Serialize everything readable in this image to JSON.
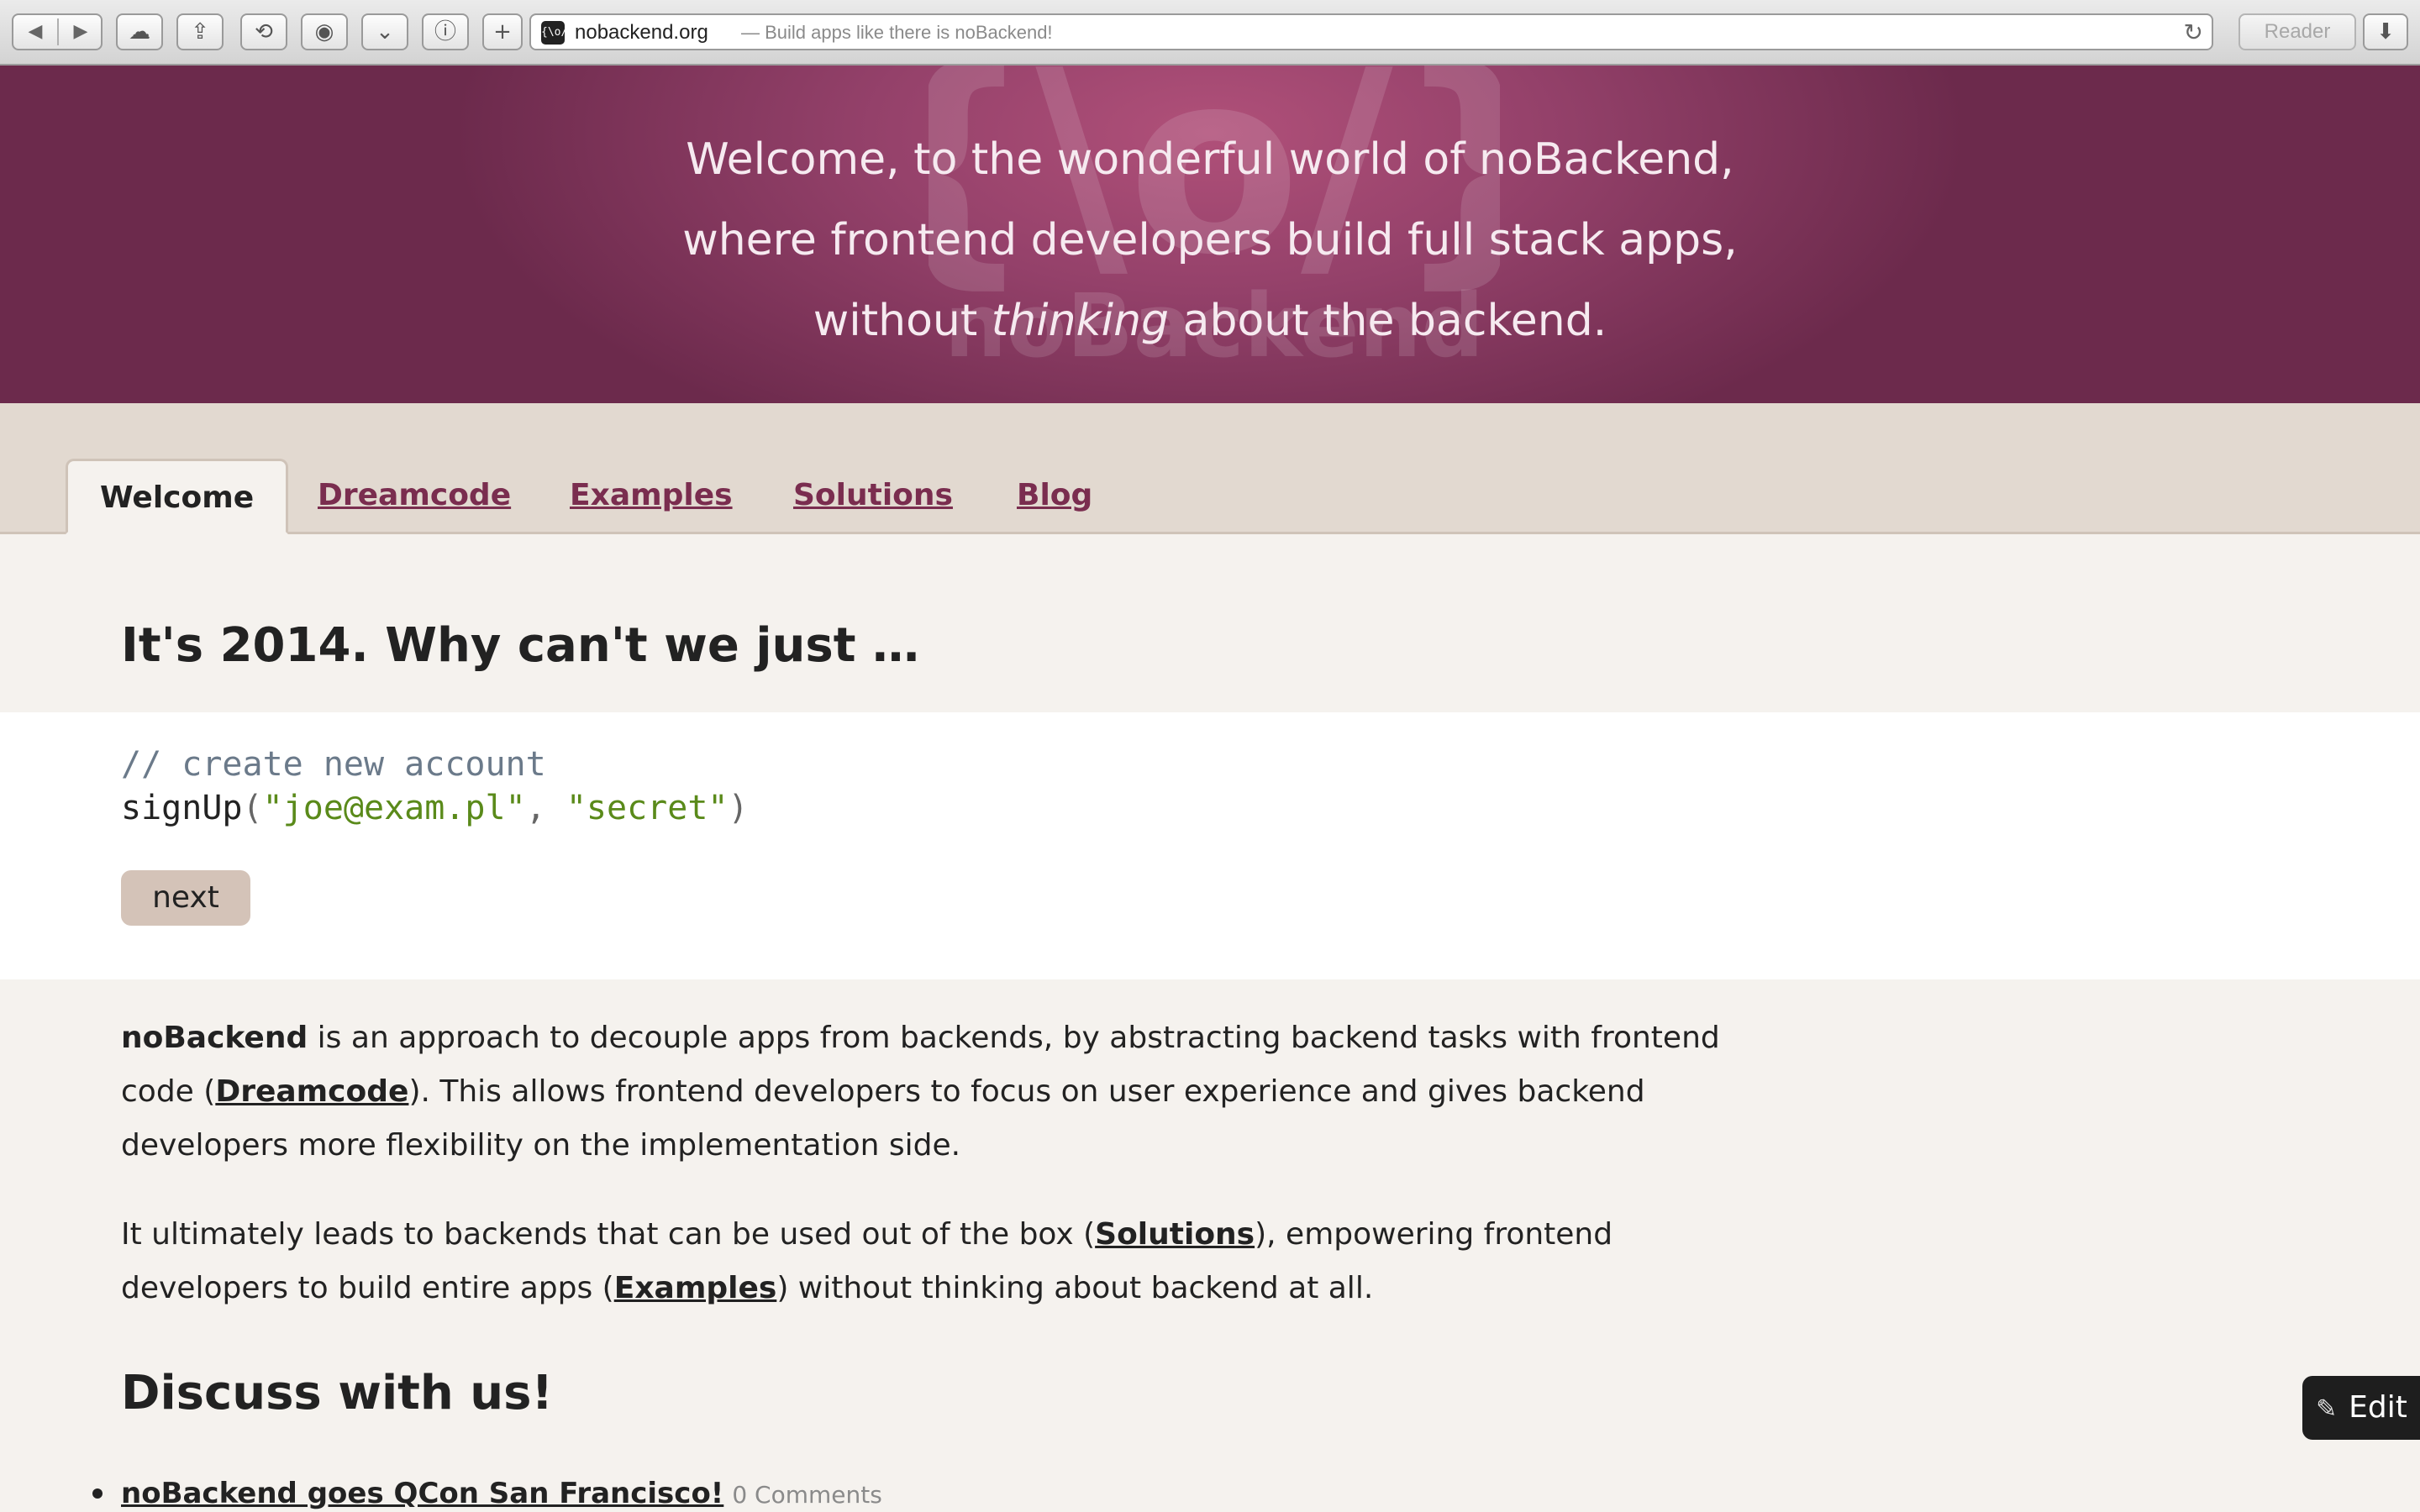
{
  "browser": {
    "url_domain": "nobackend.org",
    "url_title": "— Build apps like there is noBackend!",
    "favicon_text": "{\\o/}",
    "reader_label": "Reader",
    "buttons": [
      "back-icon",
      "forward-icon",
      "icloud-icon",
      "share-icon",
      "history-icon",
      "bookmark-icon",
      "pocket-icon",
      "info-icon",
      "new-tab-icon",
      "reload-icon",
      "downloads-icon"
    ]
  },
  "banner": {
    "line1": "Welcome, to the wonderful world of noBackend,",
    "line2": "where frontend developers build full stack apps,",
    "line3_pre": "without ",
    "line3_em": "thinking",
    "line3_post": " about the backend.",
    "logo_text": "noBackend",
    "logo_mark": "{\\o/}"
  },
  "tabs": [
    {
      "label": "Welcome",
      "active": true
    },
    {
      "label": "Dreamcode",
      "active": false
    },
    {
      "label": "Examples",
      "active": false
    },
    {
      "label": "Solutions",
      "active": false
    },
    {
      "label": "Blog",
      "active": false
    }
  ],
  "intro": {
    "heading": "It's 2014. Why can't we just …"
  },
  "code": {
    "comment": "// create new account",
    "fn": "signUp",
    "open": "(",
    "arg1": "\"joe@exam.pl\"",
    "comma": ", ",
    "arg2": "\"secret\"",
    "close": ")",
    "next_label": "next"
  },
  "para1": {
    "strong": "noBackend",
    "t1": " is an approach to decouple apps from backends, by abstracting backend tasks with frontend code (",
    "link": "Dreamcode",
    "t2": "). This allows frontend developers to focus on user experience and gives backend developers more flexibility on the implementation side."
  },
  "para2": {
    "t1": "It ultimately leads to backends that can be used out of the box (",
    "link1": "Solutions",
    "t2": "), empowering frontend developers to build entire apps (",
    "link2": "Examples",
    "t3": ") without thinking about backend at all."
  },
  "discuss": {
    "heading": "Discuss with us!",
    "items": [
      {
        "title": "noBackend goes QCon San Francisco!",
        "meta": "0 Comments"
      }
    ]
  },
  "edit": {
    "label": "Edit",
    "icon": "pencil-icon"
  },
  "colors": {
    "brand": "#94416a",
    "link": "#7a2d4f",
    "tabbar": "#e2d9d0",
    "page": "#f5f2ee"
  }
}
